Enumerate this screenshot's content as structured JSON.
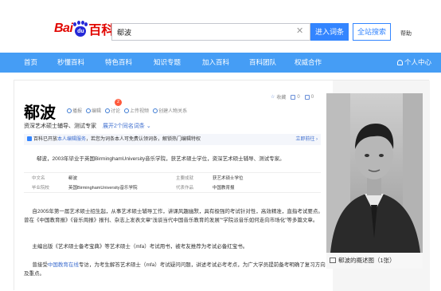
{
  "header": {
    "logo": {
      "left": "Bai",
      "paw": "du",
      "right": "百科"
    },
    "search": {
      "value": "郗波",
      "clear_icon": "close-icon"
    },
    "enter_button": "进入词条",
    "site_search_button": "全站搜索",
    "help": "帮助"
  },
  "nav": {
    "items": [
      "首页",
      "秒懂百科",
      "特色百科",
      "知识专题",
      "加入百科",
      "百科团队",
      "权威合作"
    ],
    "user": "个人中心"
  },
  "entry": {
    "title": "郗波",
    "actions": [
      "播报",
      "编辑",
      "讨论",
      "上传视频",
      "创建人物关系"
    ],
    "discuss_badge": "2",
    "stats": {
      "favorite": "收藏",
      "like": "0",
      "share": "0"
    },
    "subtitle": "资深艺术硕士辅导、测试专家",
    "more_meanings": "展开2个同名词条",
    "notice": {
      "prefix": "百科已开放",
      "link": "本人编辑服务",
      "text": "，若您为词条本人可免费认领词条，解锁热门编辑特权",
      "apply": "立即前往 ›"
    },
    "summary": "郗波，2003年毕业于英国BirminghamUniversity音乐学院，获艺术硕士学位，资深艺术硕士辅导、测试专家。",
    "info": [
      {
        "k1": "中文名",
        "v1": "郗波",
        "k2": "主要成就",
        "v2": "获艺术硕士学位"
      },
      {
        "k1": "毕业院校",
        "v1": "英国BirminghamUniversity音乐学院",
        "k2": "代表作品",
        "v2": "中国教育报"
      }
    ],
    "para1": "自2005年第一届艺术硕士招生起，从事艺术硕士辅导工作，讲课风趣幽默，具有极强的考试针对性，高效精准，直指考试要点。曾在《中国教育报》《音乐周报》报刊、杂志上发表文章“浅谈当代中国音乐教育的发展”“学院派音乐如何走向市场化”等多篇文章。",
    "para2": "主编出版《艺术硕士备考宝典》等艺术硕士（mfa）考试用书，被考友推荐为考试必备红宝书。",
    "para3_prefix": "曾接受",
    "para3_link": "中国教育在线",
    "para3_rest": "专访，为考生解答艺术硕士（mfa）考试疑问问题，讲述考试必考考点，为广大学员提前备考明确了复习方向及重点。",
    "photo_caption": "郗波的概述图（1张）"
  },
  "colors": {
    "nav": "#459df5",
    "accent": "#3385ff",
    "logo_red": "#e10601",
    "logo_blue": "#2529d8"
  }
}
